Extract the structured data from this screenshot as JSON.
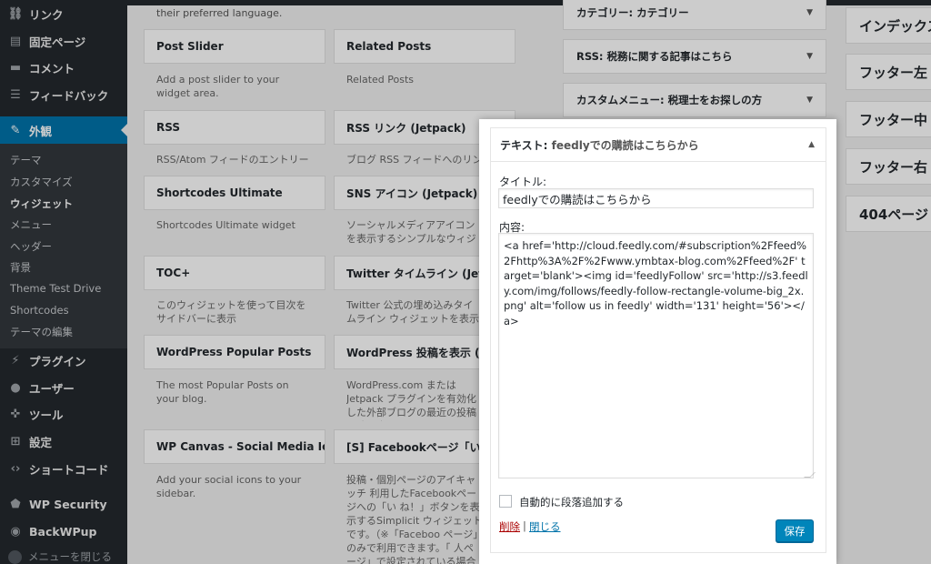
{
  "sidebar": {
    "menu": [
      {
        "label": "リンク",
        "icon": "link-icon",
        "glyph": "⛓"
      },
      {
        "label": "固定ページ",
        "icon": "page-icon",
        "glyph": "▤"
      },
      {
        "label": "コメント",
        "icon": "comment-icon",
        "glyph": "▬"
      },
      {
        "label": "フィードバック",
        "icon": "feedback-icon",
        "glyph": "☰"
      },
      {
        "label": "外観",
        "icon": "paintbrush-icon",
        "glyph": "✎"
      },
      {
        "label": "プラグイン",
        "icon": "plugin-icon",
        "glyph": "⚡"
      },
      {
        "label": "ユーザー",
        "icon": "user-icon",
        "glyph": "●"
      },
      {
        "label": "ツール",
        "icon": "wrench-icon",
        "glyph": "✜"
      },
      {
        "label": "設定",
        "icon": "settings-icon",
        "glyph": "⊞"
      },
      {
        "label": "ショートコード",
        "icon": "shortcode-icon",
        "glyph": "‹›"
      },
      {
        "label": "WP Security",
        "icon": "shield-icon",
        "glyph": "⬟"
      },
      {
        "label": "BackWPup",
        "icon": "backup-icon",
        "glyph": "◉"
      }
    ],
    "submenu": [
      "テーマ",
      "カスタマイズ",
      "ウィジェット",
      "メニュー",
      "ヘッダー",
      "背景",
      "Theme Test Drive",
      "Shortcodes",
      "テーマの編集"
    ],
    "collapse_label": "メニューを閉じる"
  },
  "widgets": {
    "intro": "their preferred language.",
    "items": [
      {
        "title": "Post Slider",
        "desc": "Add a post slider to your widget area."
      },
      {
        "title": "Related Posts",
        "desc": "Related Posts"
      },
      {
        "title": "RSS",
        "desc": "RSS/Atom フィードのエントリー"
      },
      {
        "title": "RSS リンク (Jetpack)",
        "desc": "ブログ RSS フィードへのリンク"
      },
      {
        "title": "Shortcodes Ultimate",
        "desc": "Shortcodes Ultimate widget"
      },
      {
        "title": "SNS アイコン (Jetpack)",
        "desc": "ソーシャルメディアアイコンを表示するシンプルなウィジェット。"
      },
      {
        "title": "TOC+",
        "desc": "このウィジェットを使って目次をサイドバーに表示"
      },
      {
        "title": "Twitter タイムライン (Jetpack)",
        "desc": "Twitter 公式の埋め込みタイムライン ウィジェットを表示します。"
      },
      {
        "title": "WordPress Popular Posts",
        "desc": "The most Popular Posts on your blog."
      },
      {
        "title": "WordPress 投稿を表示 (Jetpack)",
        "desc": "WordPress.com または Jetpack プラグインを有効化した外部ブログの最近の投稿一覧を表示"
      },
      {
        "title": "WP Canvas - Social Media Ic...",
        "desc": "Add your social icons to your sidebar."
      },
      {
        "title": "[S] Facebookページ「いいね」",
        "desc": "投稿・個別ページのアイキャッチ 利用したFacebookページへの「い ね！」ボタンを表示するSimplicit ウィジェットです。（※「Faceboo ページ」のみで利用できます。「 人ページ」で設定されている場合 利用できません）"
      }
    ]
  },
  "area_widgets": [
    {
      "title": "カテゴリー:",
      "sub": " カテゴリー"
    },
    {
      "title": "RSS:",
      "sub": " 税務に関する記事はこちら"
    },
    {
      "title": "カスタムメニュー:",
      "sub": " 税理士をお探しの方"
    }
  ],
  "right_areas": [
    "インデックス",
    "フッター左",
    "フッター中",
    "フッター右",
    "404ページ"
  ],
  "editor": {
    "header_title": "テキスト:",
    "header_sub": " feedlyでの購読はこちらから",
    "title_label": "タイトル:",
    "title_value": "feedlyでの購読はこちらから",
    "content_label": "内容:",
    "content_value": "<a href='http://cloud.feedly.com/#subscription%2Ffeed%2Fhttp%3A%2F%2Fwww.ymbtax-blog.com%2Ffeed%2F' target='blank'><img id='feedlyFollow' src='http://s3.feedly.com/img/follows/feedly-follow-rectangle-volume-big_2x.png' alt='follow us in feedly' width='131' height='56'></a>",
    "autop_label": "自動的に段落追加する",
    "autop_checked": false,
    "delete_label": "削除",
    "separator": "|",
    "close_label": "閉じる",
    "save_label": "保存"
  },
  "colors": {
    "sidebar_bg": "#23282d",
    "active_menu": "#0073aa",
    "save_button": "#0085ba",
    "delete_link": "#aa0000",
    "close_link": "#0073aa"
  }
}
